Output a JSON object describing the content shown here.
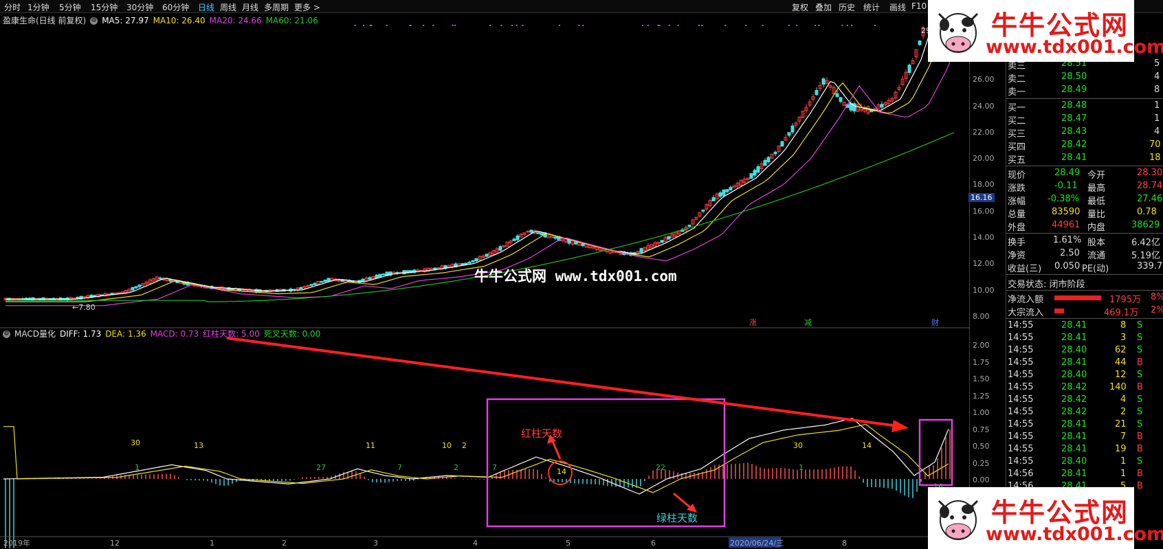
{
  "toolbar": {
    "periods": [
      "分时",
      "1分钟",
      "5分钟",
      "15分钟",
      "30分钟",
      "60分钟",
      "日线",
      "周线",
      "月线",
      "多周期",
      "更多 >"
    ],
    "active_period": "日线",
    "right": [
      "复权",
      "叠加",
      "历史",
      "统计",
      "画线",
      "F10"
    ]
  },
  "chart_header": {
    "title": "盈康生命(日线 前复权)",
    "ma5": "MA5: 27.97",
    "ma10": "MA10: 26.40",
    "ma20": "MA20: 24.66",
    "ma60": "MA60: 21.06"
  },
  "price_axis": [
    "26.00",
    "24.00",
    "22.00",
    "20.00",
    "18.00",
    "16.00",
    "14.00",
    "12.00",
    "10.00",
    "8.00"
  ],
  "price_marks": {
    "top": "29.71",
    "low": "7.80",
    "current_box": "16.16"
  },
  "event_badges": [
    "涨",
    "减",
    "财"
  ],
  "indicator_header": {
    "name": "MACD量化",
    "diff": "DIFF: 1.73",
    "dea": "DEA: 1.36",
    "macd": "MACD: 0.73",
    "red_days": "红柱天数: 5.00",
    "dead_days": "死叉天数: 0.00"
  },
  "macd_axis": [
    "2.00",
    "1.75",
    "1.50",
    "1.25",
    "1.00",
    "0.75",
    "0.50",
    "0.25",
    "0.00"
  ],
  "red_counts": [
    "30",
    "13",
    "11",
    "10",
    "2",
    "14",
    "30",
    "14"
  ],
  "green_counts": [
    "1",
    "27",
    "7",
    "2",
    "7",
    "22",
    "1",
    "16"
  ],
  "annotations": {
    "red_label": "红柱天数",
    "green_label": "绿柱天数",
    "circle_value": "14"
  },
  "watermark": {
    "center": "牛牛公式网 www.tdx001.com",
    "logo_cn": "牛牛公式网",
    "logo_url": "www.tdx001.com"
  },
  "date_axis": [
    "2019年",
    "12",
    "1",
    "2",
    "3",
    "4",
    "5",
    "6",
    "2020/06/24/三",
    "8"
  ],
  "quote": {
    "asks": [
      {
        "label": "卖三",
        "price": "28.51",
        "vol": "5"
      },
      {
        "label": "卖二",
        "price": "28.50",
        "vol": "4"
      },
      {
        "label": "卖一",
        "price": "28.49",
        "vol": "8"
      }
    ],
    "bids": [
      {
        "label": "买一",
        "price": "28.48",
        "vol": "1"
      },
      {
        "label": "买二",
        "price": "28.47",
        "vol": "1"
      },
      {
        "label": "买三",
        "price": "28.43",
        "vol": "4"
      },
      {
        "label": "买四",
        "price": "28.42",
        "vol": "70"
      },
      {
        "label": "买五",
        "price": "28.41",
        "vol": "18"
      }
    ],
    "stats": [
      {
        "l1": "现价",
        "v1": "28.49",
        "l2": "今开",
        "v2": "28.30"
      },
      {
        "l1": "涨跌",
        "v1": "-0.11",
        "l2": "最高",
        "v2": "28.74"
      },
      {
        "l1": "涨幅",
        "v1": "-0.38%",
        "l2": "最低",
        "v2": "27.46"
      },
      {
        "l1": "总量",
        "v1": "83590",
        "l2": "量比",
        "v2": "0.78"
      },
      {
        "l1": "外盘",
        "v1": "44961",
        "l2": "内盘",
        "v2": "38629"
      }
    ],
    "stats2": [
      {
        "l1": "换手",
        "v1": "1.61%",
        "l2": "股本",
        "v2": "6.42亿"
      },
      {
        "l1": "净资",
        "v1": "2.50",
        "l2": "流通",
        "v2": "5.19亿"
      },
      {
        "l1": "收益(三)",
        "v1": "0.050",
        "l2": "PE(动)",
        "v2": "339.7"
      }
    ],
    "trade_status": "交易状态: 闭市阶段",
    "flows": [
      {
        "label": "净流入额",
        "value": "1795万",
        "pct": "8%"
      },
      {
        "label": "大宗流入",
        "value": "469.1万",
        "pct": "2%"
      }
    ],
    "ticks": [
      {
        "t": "14:55",
        "p": "28.41",
        "v": "8",
        "s": "S"
      },
      {
        "t": "14:55",
        "p": "28.41",
        "v": "3",
        "s": "S"
      },
      {
        "t": "14:55",
        "p": "28.40",
        "v": "62",
        "s": "S"
      },
      {
        "t": "14:55",
        "p": "28.41",
        "v": "44",
        "s": "B"
      },
      {
        "t": "14:55",
        "p": "28.40",
        "v": "12",
        "s": "S"
      },
      {
        "t": "14:55",
        "p": "28.42",
        "v": "140",
        "s": "B"
      },
      {
        "t": "14:55",
        "p": "28.42",
        "v": "4",
        "s": "S"
      },
      {
        "t": "14:55",
        "p": "28.42",
        "v": "2",
        "s": "S"
      },
      {
        "t": "14:55",
        "p": "28.41",
        "v": "21",
        "s": "S"
      },
      {
        "t": "14:55",
        "p": "28.41",
        "v": "7",
        "s": "B"
      },
      {
        "t": "14:55",
        "p": "28.41",
        "v": "19",
        "s": "B"
      },
      {
        "t": "14:55",
        "p": "28.40",
        "v": "1",
        "s": "S"
      },
      {
        "t": "14:56",
        "p": "28.41",
        "v": "1",
        "s": "B"
      },
      {
        "t": "14:56",
        "p": "28.41",
        "v": "5",
        "s": "B"
      }
    ]
  },
  "colors": {
    "up": "#ff4040",
    "down": "#40e0e0",
    "ma5": "#ffffff",
    "ma10": "#f0e020",
    "ma20": "#e040e0",
    "ma60": "#22c022"
  }
}
